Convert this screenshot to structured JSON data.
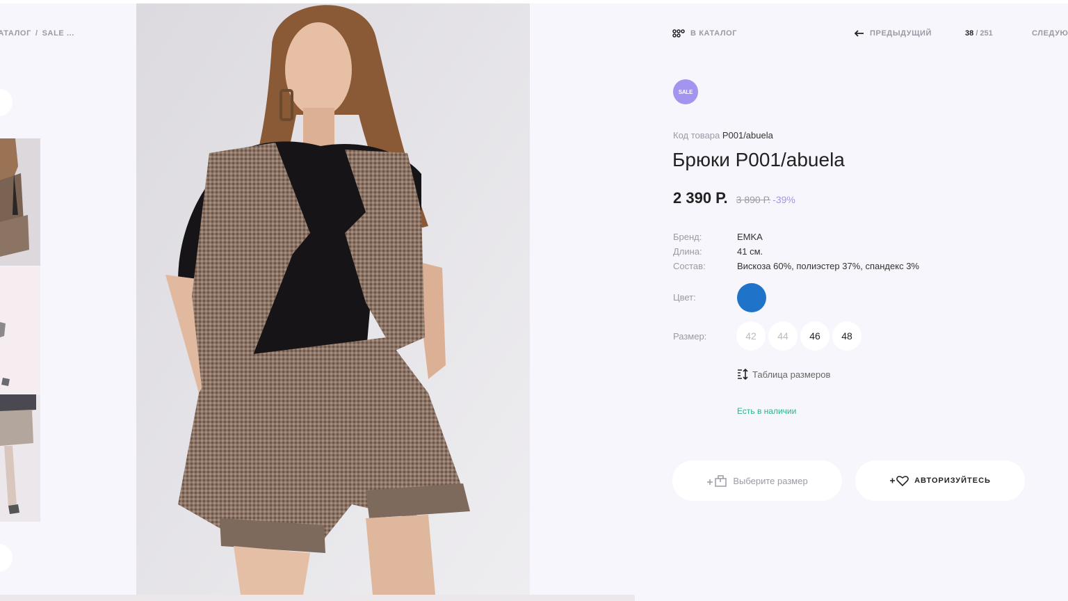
{
  "breadcrumb": {
    "items": [
      "КАТАЛОГ",
      "SALE",
      "..."
    ],
    "sep": "/"
  },
  "nav": {
    "catalog_label": "В КАТАЛОГ",
    "prev_label": "ПРЕДЫДУЩИЙ",
    "counter_current": "38",
    "counter_total": "/ 251",
    "next_label": "СЛЕДУЮЩИЙ"
  },
  "product": {
    "badge": "SALE",
    "code_label": "Код товара",
    "code": "P001/abuela",
    "title": "Брюки P001/abuela",
    "price": "2 390 Р.",
    "old_price": "3 890 Р.",
    "discount": "-39%",
    "attributes": [
      {
        "label": "Бренд:",
        "value": "EMKA"
      },
      {
        "label": "Длина:",
        "value": "41 см."
      },
      {
        "label": "Состав:",
        "value": "Вискоза 60%, полиэстер 37%, спандекс 3%"
      }
    ],
    "color_label": "Цвет:",
    "color_hex": "#1f74c9",
    "size_label": "Размер:",
    "sizes": [
      {
        "value": "42",
        "available": false
      },
      {
        "value": "44",
        "available": false
      },
      {
        "value": "46",
        "available": true
      },
      {
        "value": "48",
        "available": true
      }
    ],
    "size_table_label": "Таблица размеров",
    "stock_status": "Есть в наличии"
  },
  "actions": {
    "cart_label": "Выберите размер",
    "login_label": "АВТОРИЗУЙТЕСЬ"
  },
  "colors": {
    "accent": "#a394f0",
    "stock_green": "#2bb38a",
    "background": "#f6f6fc"
  }
}
